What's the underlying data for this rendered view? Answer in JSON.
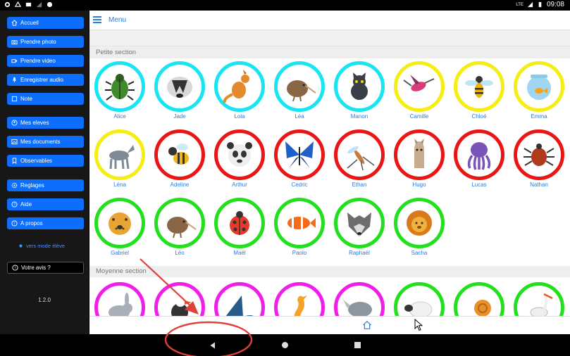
{
  "status_bar": {
    "time": "09:08",
    "network": "LTE"
  },
  "sidebar": {
    "items": [
      {
        "label": "Accueil",
        "icon": "home-icon"
      },
      {
        "label": "Prendre photo",
        "icon": "camera-icon"
      },
      {
        "label": "Prendre video",
        "icon": "video-icon"
      },
      {
        "label": "Enregistrer audio",
        "icon": "microphone-icon"
      },
      {
        "label": "Note",
        "icon": "note-icon"
      },
      {
        "label": "Mes eleves",
        "icon": "students-icon"
      },
      {
        "label": "Mes documents",
        "icon": "documents-icon"
      },
      {
        "label": "Observables",
        "icon": "bookmark-icon"
      },
      {
        "label": "Reglages",
        "icon": "settings-icon"
      },
      {
        "label": "Aide",
        "icon": "help-icon"
      },
      {
        "label": "A propos",
        "icon": "info-icon"
      }
    ],
    "mode_link": "vers mode élève",
    "feedback": "Votre avis ?",
    "version": "1.2.0"
  },
  "header": {
    "title": "Menu"
  },
  "sections": [
    {
      "title": "Petite section",
      "students": [
        {
          "name": "Alice",
          "ring": "#19e5f2",
          "animal": "beetle"
        },
        {
          "name": "Jade",
          "ring": "#19e5f2",
          "animal": "badger"
        },
        {
          "name": "Lola",
          "ring": "#19e5f2",
          "animal": "kangaroo"
        },
        {
          "name": "Léa",
          "ring": "#19e5f2",
          "animal": "kiwi"
        },
        {
          "name": "Manon",
          "ring": "#19e5f2",
          "animal": "cat"
        },
        {
          "name": "Camille",
          "ring": "#f5ee13",
          "animal": "hummingbird"
        },
        {
          "name": "Chloé",
          "ring": "#f5ee13",
          "animal": "wasp"
        },
        {
          "name": "Emma",
          "ring": "#f5ee13",
          "animal": "fishbowl"
        },
        {
          "name": "Léna",
          "ring": "#f5ee13",
          "animal": "horse"
        },
        {
          "name": "Adeline",
          "ring": "#ea1616",
          "animal": "bee"
        },
        {
          "name": "Arthur",
          "ring": "#ea1616",
          "animal": "panda"
        },
        {
          "name": "Cedric",
          "ring": "#ea1616",
          "animal": "butterfly"
        },
        {
          "name": "Ethan",
          "ring": "#ea1616",
          "animal": "mosquito"
        },
        {
          "name": "Hugo",
          "ring": "#ea1616",
          "animal": "llama"
        },
        {
          "name": "Lucas",
          "ring": "#ea1616",
          "animal": "octopus"
        },
        {
          "name": "Nathan",
          "ring": "#ea1616",
          "animal": "tick"
        },
        {
          "name": "Gabriel",
          "ring": "#22e01e",
          "animal": "leopard"
        },
        {
          "name": "Léo",
          "ring": "#22e01e",
          "animal": "kiwi"
        },
        {
          "name": "Maël",
          "ring": "#22e01e",
          "animal": "ladybug"
        },
        {
          "name": "Paolo",
          "ring": "#22e01e",
          "animal": "clownfish"
        },
        {
          "name": "Raphaël",
          "ring": "#22e01e",
          "animal": "wolf"
        },
        {
          "name": "Sacha",
          "ring": "#22e01e",
          "animal": "lion"
        }
      ]
    },
    {
      "title": "Moyenne section",
      "students": [
        {
          "name": "",
          "ring": "#ef1ee8",
          "animal": "rabbit"
        },
        {
          "name": "",
          "ring": "#ef1ee8",
          "animal": "puffin"
        },
        {
          "name": "",
          "ring": "#ef1ee8",
          "animal": "shark"
        },
        {
          "name": "",
          "ring": "#ef1ee8",
          "animal": "seahorse"
        },
        {
          "name": "",
          "ring": "#ef1ee8",
          "animal": "rhino"
        },
        {
          "name": "",
          "ring": "#22e01e",
          "animal": "sheep"
        },
        {
          "name": "",
          "ring": "#22e01e",
          "animal": "snail"
        },
        {
          "name": "",
          "ring": "#22e01e",
          "animal": "stork"
        }
      ]
    }
  ],
  "colors": {
    "accent": "#2a7de1",
    "button": "#0d6efd",
    "annotation": "#e0403a"
  }
}
